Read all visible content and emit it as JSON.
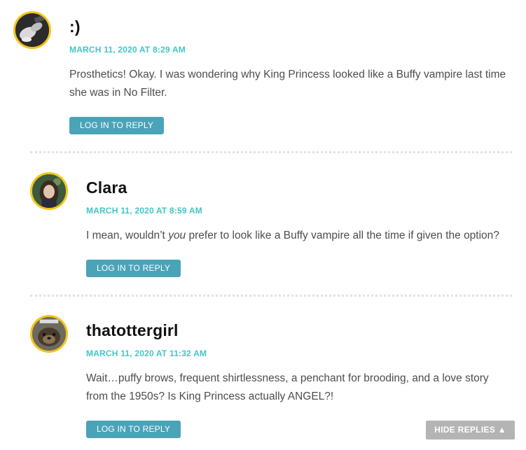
{
  "comments": [
    {
      "author": ":)",
      "timestamp": "MARCH 11, 2020 AT 8:29 AM",
      "body": "Prosthetics! Okay. I was wondering why King Princess looked like a Buffy vampire last time she was in No Filter.",
      "reply_label": "LOG IN TO REPLY",
      "avatar_icon": "hands-photo-avatar"
    },
    {
      "author": "Clara",
      "timestamp": "MARCH 11, 2020 AT 8:59 AM",
      "body_before": "I mean, wouldn’t ",
      "body_em": "you",
      "body_after": " prefer to look like a Buffy vampire all the time if given the option?",
      "reply_label": "LOG IN TO REPLY",
      "avatar_icon": "portrait-avatar"
    },
    {
      "author": "thatottergirl",
      "timestamp": "MARCH 11, 2020 AT 11:32 AM",
      "body": "Wait…puffy brows, frequent shirtlessness, a penchant for brooding, and a love story from the 1950s? Is King Princess actually ANGEL?!",
      "reply_label": "LOG IN TO REPLY",
      "avatar_icon": "otter-avatar"
    }
  ],
  "hide_replies_label": "HIDE REPLIES ▲",
  "colors": {
    "accent_teal": "#3fc8c6",
    "button_blue": "#4ba3b8",
    "avatar_ring": "#f5c518",
    "hide_button": "#b4b4b4"
  }
}
